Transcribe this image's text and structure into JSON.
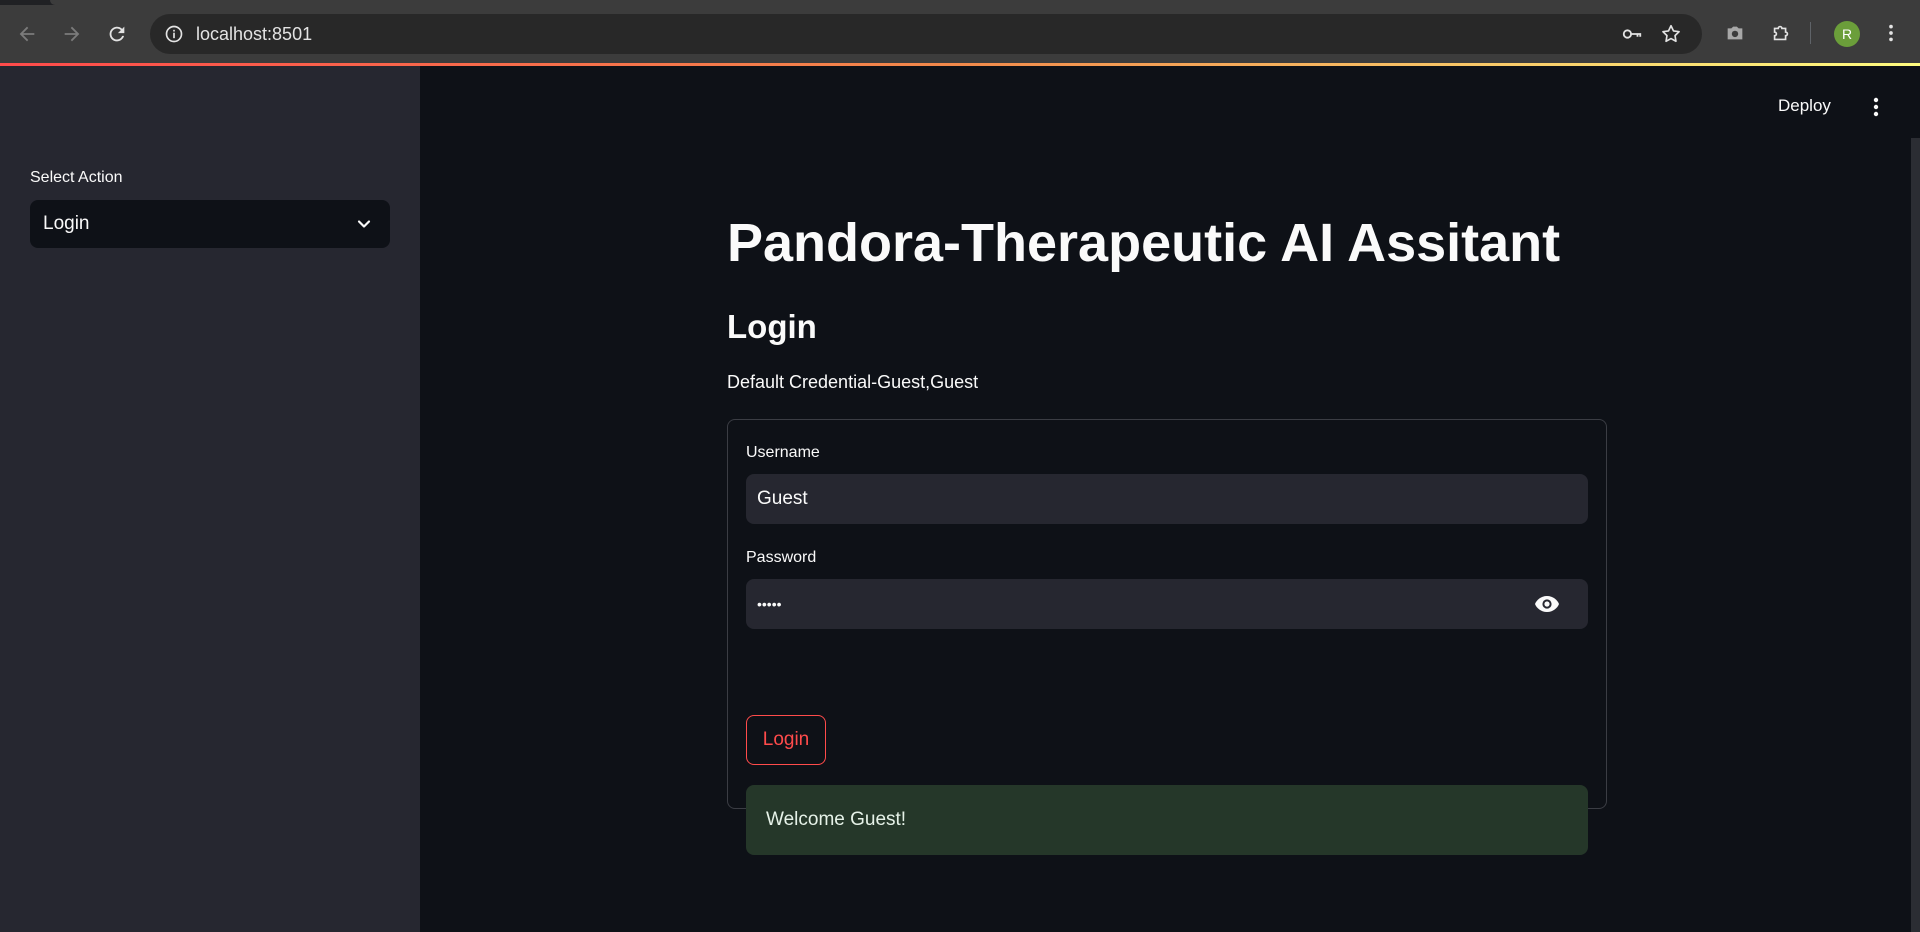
{
  "browser": {
    "url": "localhost:8501",
    "profile_initial": "R",
    "icons": {
      "back": "arrow-left-icon",
      "forward": "arrow-right-icon",
      "reload": "reload-icon",
      "site_info": "info-icon",
      "passwords": "key-icon",
      "bookmark": "star-icon",
      "screenshot": "camera-icon",
      "extensions": "puzzle-icon",
      "menu": "kebab-icon"
    }
  },
  "sidebar": {
    "select_label": "Select Action",
    "select_value": "Login"
  },
  "header": {
    "deploy_label": "Deploy"
  },
  "main": {
    "title": "Pandora-Therapeutic AI Assitant",
    "subtitle": "Login",
    "credential_note": "Default Credential-Guest,Guest",
    "form": {
      "username_label": "Username",
      "username_value": "Guest",
      "password_label": "Password",
      "password_value": "•••••",
      "login_button": "Login",
      "success_message": "Welcome Guest!"
    }
  },
  "colors": {
    "accent": "#ff4b4b",
    "sidebar_bg": "#262730",
    "main_bg": "#0e1117",
    "success_bg": "#253729"
  }
}
